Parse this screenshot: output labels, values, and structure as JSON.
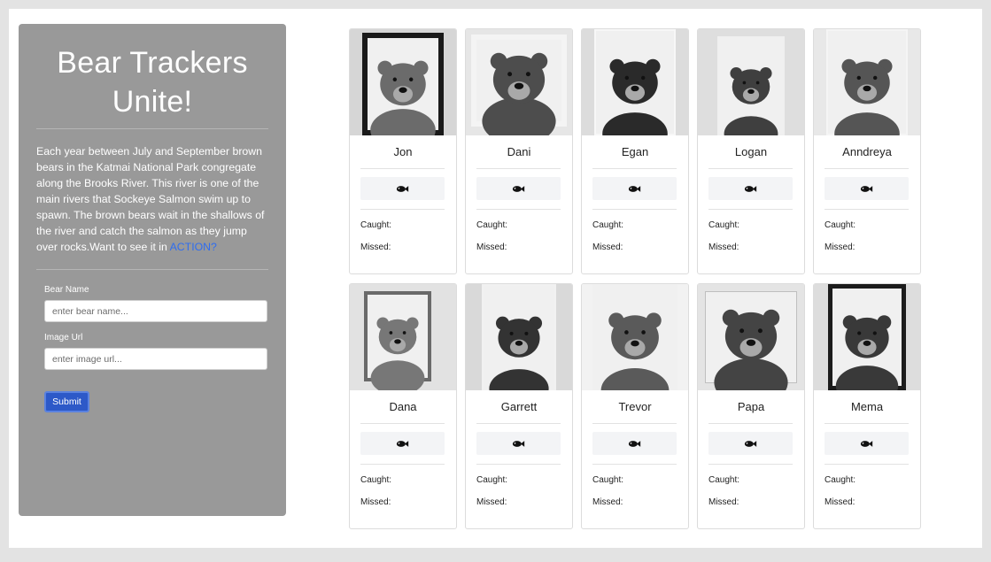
{
  "sidebar": {
    "title_line1": "Bear Trackers",
    "title_line2": "Unite!",
    "intro_text": "Each year between July and September brown bears in the Katmai National Park congregate along the Brooks River. This river is one of the main rivers that Sockeye Salmon swim up to spawn. The brown bears wait in the shallows of the river and catch the salmon as they jump over rocks.Want to see it in ",
    "action_link": "ACTION?",
    "form": {
      "name_label": "Bear Name",
      "name_placeholder": "enter bear name...",
      "image_label": "Image Url",
      "image_placeholder": "enter image url...",
      "submit_label": "Submit"
    }
  },
  "card_labels": {
    "caught": "Caught:",
    "missed": "Missed:",
    "fish_icon": "fish-icon"
  },
  "bears": [
    {
      "name": "Jon"
    },
    {
      "name": "Dani"
    },
    {
      "name": "Egan"
    },
    {
      "name": "Logan"
    },
    {
      "name": "Anndreya"
    },
    {
      "name": "Dana"
    },
    {
      "name": "Garrett"
    },
    {
      "name": "Trevor"
    },
    {
      "name": "Papa"
    },
    {
      "name": "Mema"
    }
  ],
  "colors": {
    "sidebar_bg": "#999999",
    "link": "#2f6df0",
    "submit_bg": "#2d59c8",
    "page_bg": "#ffffff",
    "outer_bg": "#e3e3e3"
  }
}
